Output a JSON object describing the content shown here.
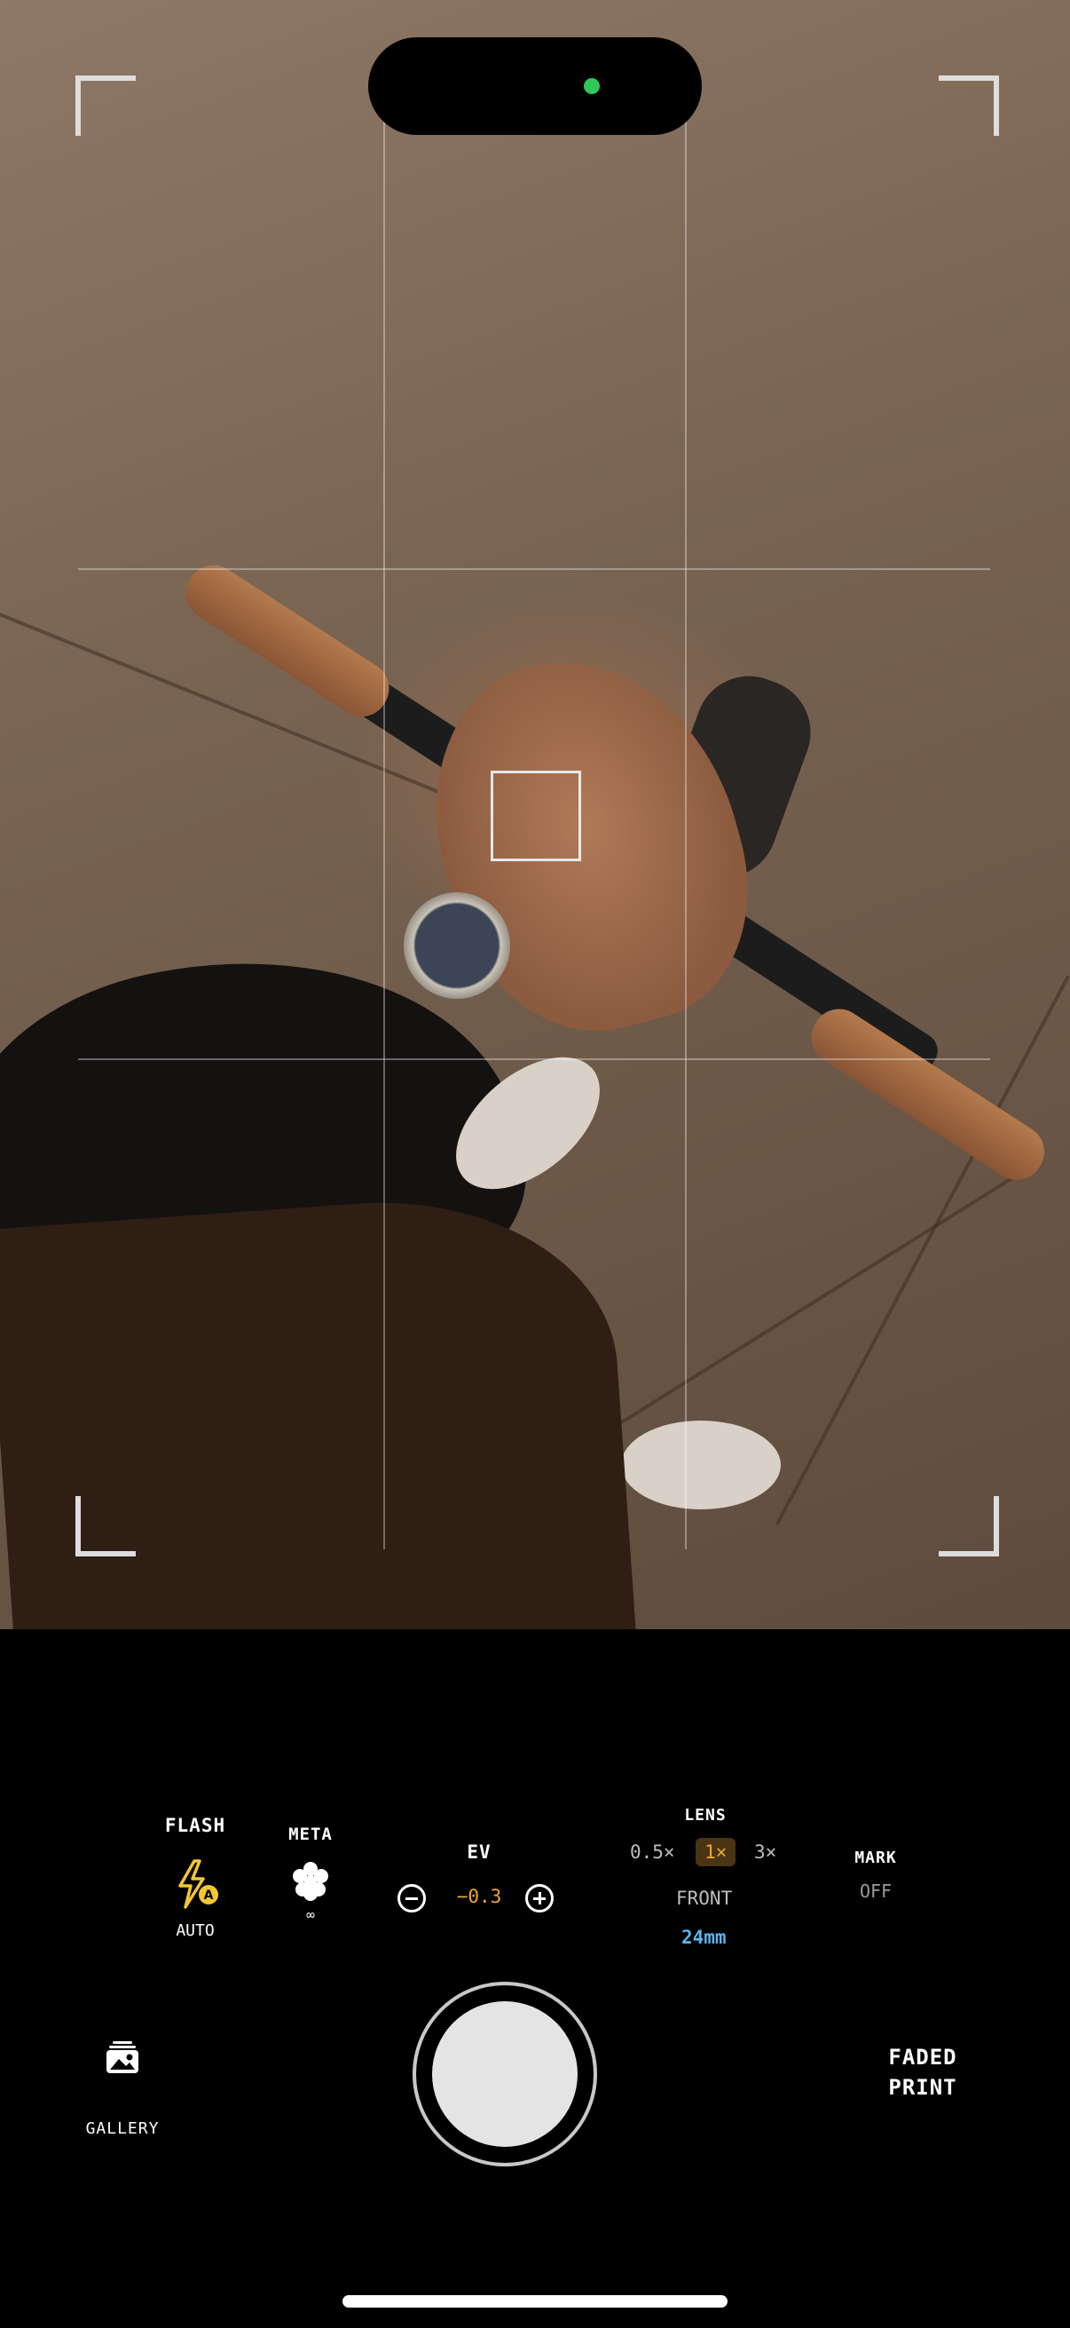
{
  "controls": {
    "flash": {
      "label": "FLASH",
      "mode": "AUTO",
      "icon": "flash-auto-icon",
      "accent": "#f2c832"
    },
    "meta": {
      "label": "META",
      "value": "∞",
      "icon": "flower-icon"
    },
    "ev": {
      "label": "EV",
      "value": "−0.3",
      "value_color": "#f0a72a"
    },
    "lens": {
      "label": "LENS",
      "options": [
        "0.5×",
        "1×",
        "3×"
      ],
      "selected": "1×",
      "front_label": "FRONT",
      "focal_length": "24mm",
      "focal_color": "#5ab2ee"
    },
    "mark": {
      "label": "MARK",
      "value": "OFF"
    }
  },
  "bottom": {
    "gallery_label": "GALLERY",
    "film_profile": "FADED\nPRINT"
  },
  "status": {
    "camera_indicator_color": "#2fc85a"
  }
}
